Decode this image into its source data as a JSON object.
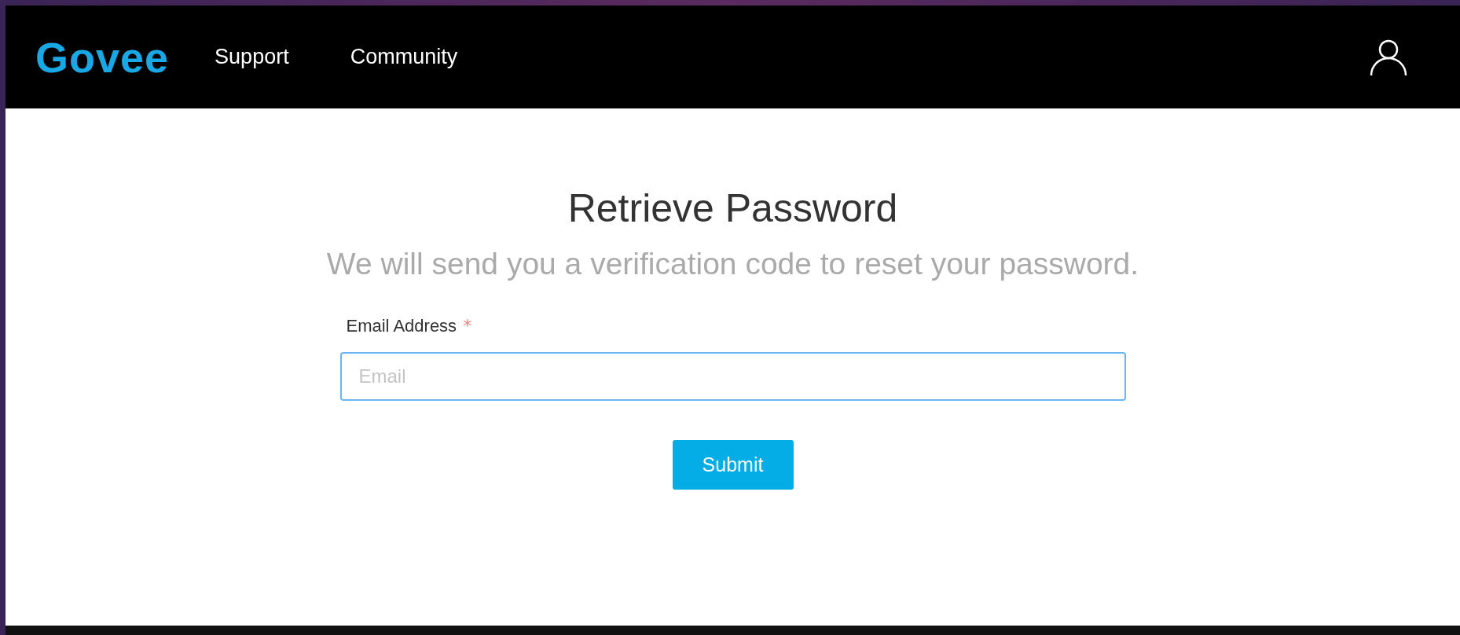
{
  "header": {
    "logo": "Govee",
    "nav": [
      {
        "label": "Support"
      },
      {
        "label": "Community"
      }
    ]
  },
  "form": {
    "title": "Retrieve Password",
    "subtitle": "We will send you a verification code to reset your password.",
    "email": {
      "label": "Email Address",
      "required_mark": "*",
      "placeholder": "Email"
    },
    "submit": "Submit"
  }
}
